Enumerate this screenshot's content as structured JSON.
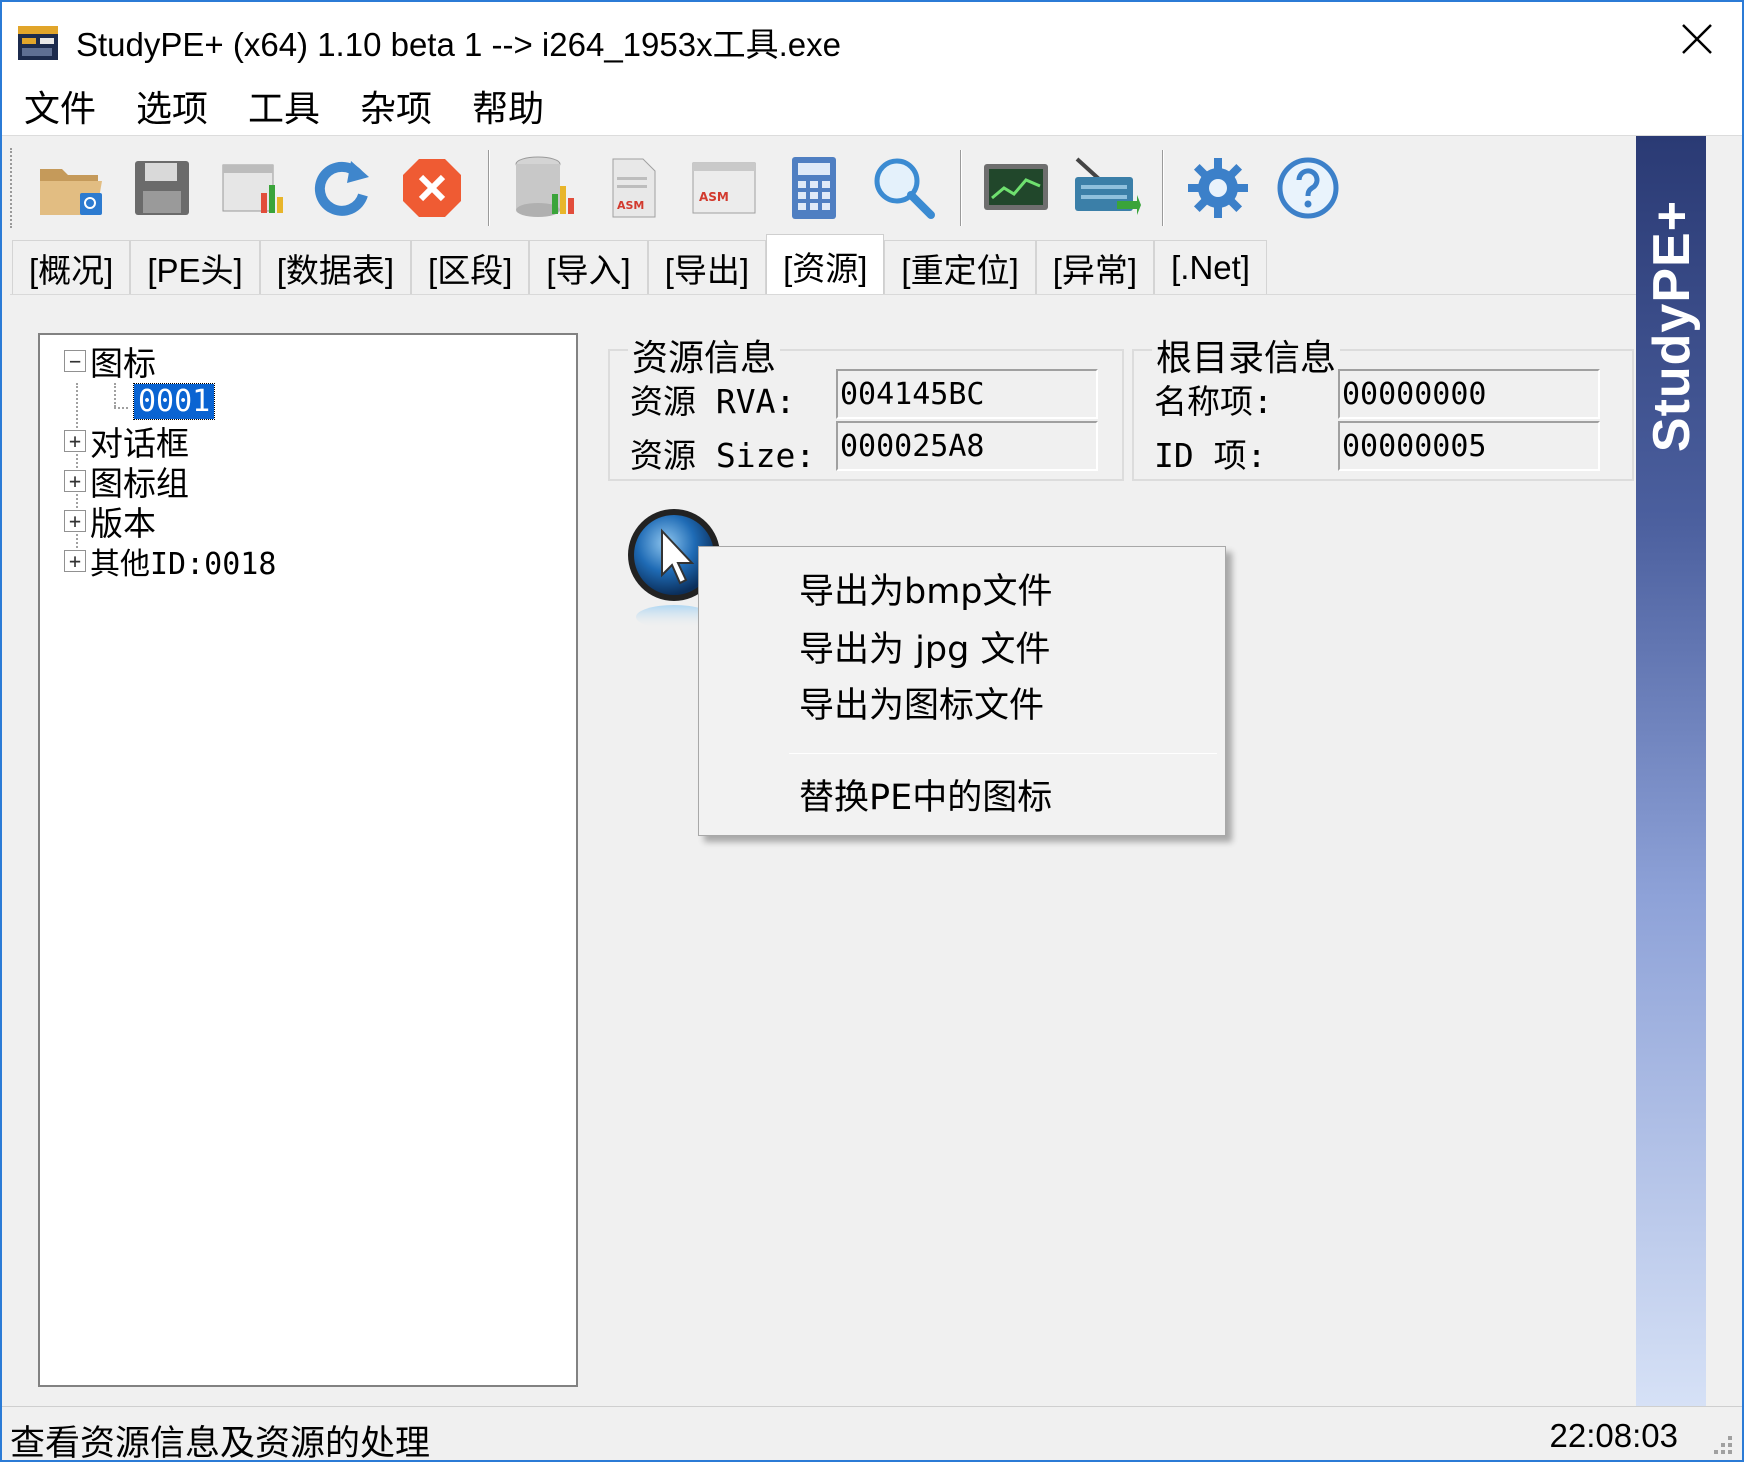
{
  "window": {
    "title": "StudyPE+ (x64) 1.10 beta 1  --> i264_1953x工具.exe"
  },
  "menu": [
    "文件",
    "选项",
    "工具",
    "杂项",
    "帮助"
  ],
  "toolbar": {
    "icons": [
      "open-folder-icon",
      "save-icon",
      "compare-icon",
      "refresh-icon",
      "close-file-icon",
      "database-icon",
      "asm-file-icon",
      "asm-view-icon",
      "calculator-icon",
      "search-icon",
      "monitor-icon",
      "basket-icon",
      "settings-gear-icon",
      "help-icon"
    ]
  },
  "tabs": [
    "[概况]",
    "[PE头]",
    "[数据表]",
    "[区段]",
    "[导入]",
    "[导出]",
    "[资源]",
    "[重定位]",
    "[异常]",
    "[.Net]"
  ],
  "active_tab": "[资源]",
  "tree": {
    "nodes": [
      {
        "label": "图标",
        "expanded": true,
        "children": [
          "0001"
        ]
      },
      {
        "label": "对话框",
        "expanded": false
      },
      {
        "label": "图标组",
        "expanded": false
      },
      {
        "label": "版本",
        "expanded": false
      },
      {
        "label": "其他ID:0018",
        "expanded": false
      }
    ],
    "selected": "0001"
  },
  "resource_info": {
    "title": "资源信息",
    "rva_label": "资源 RVA:",
    "rva_value": "004145BC",
    "size_label": "资源 Size:",
    "size_value": "000025A8"
  },
  "root_info": {
    "title": "根目录信息",
    "name_label": "名称项:",
    "name_value": "00000000",
    "id_label": "ID  项:",
    "id_value": "00000005"
  },
  "context_menu": {
    "items": [
      "导出为bmp文件",
      "导出为 jpg 文件",
      "导出为图标文件",
      "替换PE中的图标"
    ]
  },
  "banner": {
    "text": "StudyPE+"
  },
  "status": {
    "text": "查看资源信息及资源的处理",
    "time": "22:08:03"
  },
  "colors": {
    "accent": "#0a64d2",
    "window_border": "#2b7bd6",
    "banner_top": "#2a3a74",
    "banner_bottom": "#d6e1f6"
  }
}
